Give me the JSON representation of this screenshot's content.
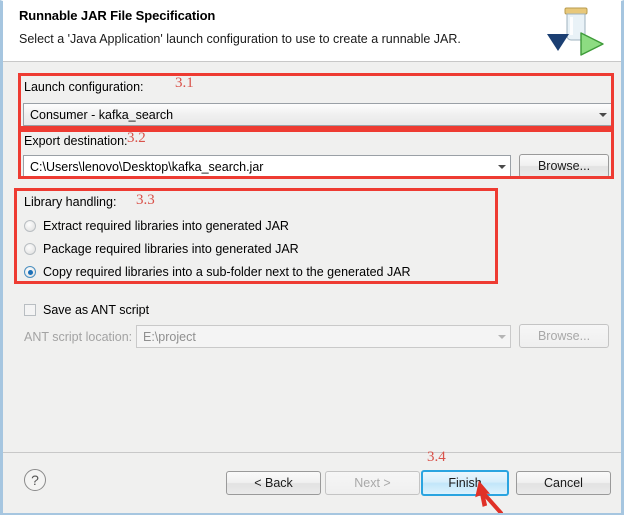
{
  "dialog": {
    "title": "Runnable JAR File Specification",
    "description": "Select a 'Java Application' launch configuration to use to create a runnable JAR.",
    "icon": "jar-export-icon"
  },
  "launch_configuration": {
    "label": "Launch configuration:",
    "annotation": "3.1",
    "value": "Consumer - kafka_search"
  },
  "export_destination": {
    "label": "Export destination:",
    "annotation": "3.2",
    "value": "C:\\Users\\lenovo\\Desktop\\kafka_search.jar",
    "browse_label": "Browse..."
  },
  "library_handling": {
    "label": "Library handling:",
    "annotation": "3.3",
    "options": [
      {
        "label": "Extract required libraries into generated JAR",
        "selected": false
      },
      {
        "label": "Package required libraries into generated JAR",
        "selected": false
      },
      {
        "label": "Copy required libraries into a sub-folder next to the generated JAR",
        "selected": true
      }
    ]
  },
  "ant": {
    "checkbox_label": "Save as ANT script",
    "checked": false,
    "location_label": "ANT script location:",
    "location_value": "E:\\project",
    "browse_label": "Browse...",
    "enabled": false
  },
  "footer": {
    "annotation": "3.4",
    "help_icon": "?",
    "buttons": {
      "back": "< Back",
      "next": "Next >",
      "finish": "Finish",
      "cancel": "Cancel"
    }
  },
  "colors": {
    "annotation_red": "#ee3b32",
    "annotation_text": "#d9524a",
    "focus_blue": "#2aa4e0",
    "radio_blue": "#1b70b8",
    "dialog_border": "#a6c6e0"
  }
}
